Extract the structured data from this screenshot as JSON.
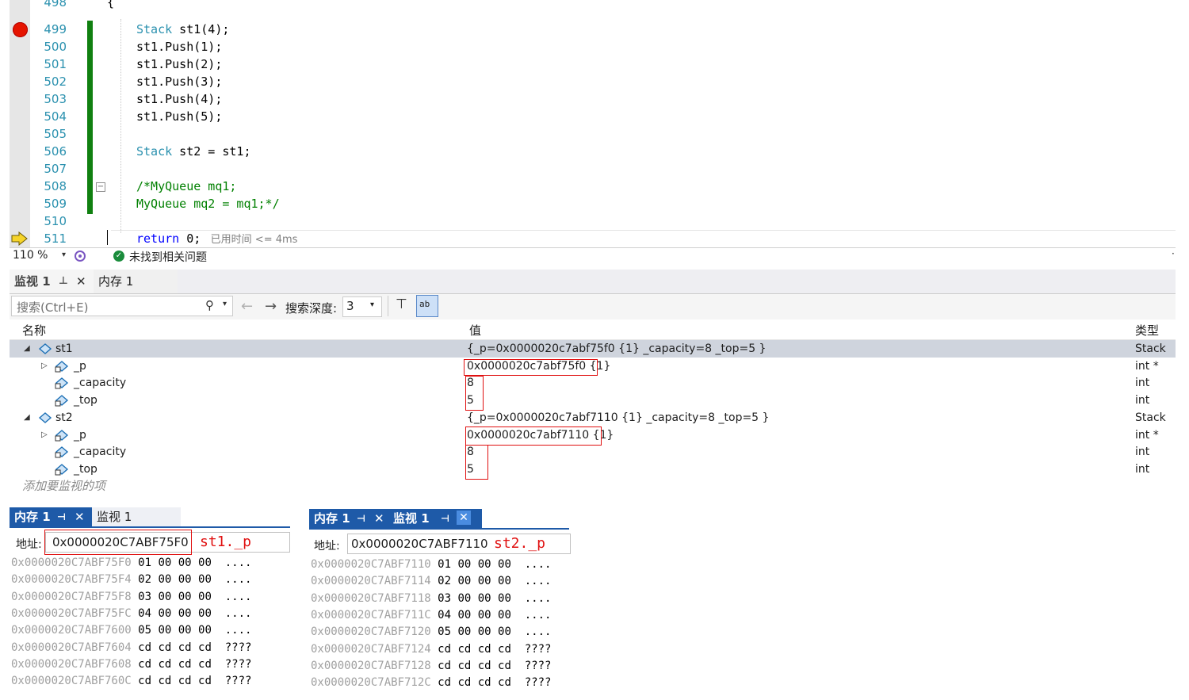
{
  "editor": {
    "lines": [
      {
        "num": "498",
        "code_parts": [
          {
            "t": "{",
            "c": "plain"
          }
        ]
      },
      {
        "num": "499",
        "code_parts": [
          {
            "t": "Stack",
            "c": "kw-type"
          },
          {
            "t": " st1(4);",
            "c": "plain"
          }
        ]
      },
      {
        "num": "500",
        "code_parts": [
          {
            "t": "st1.Push(1);",
            "c": "plain"
          }
        ]
      },
      {
        "num": "501",
        "code_parts": [
          {
            "t": "st1.Push(2);",
            "c": "plain"
          }
        ]
      },
      {
        "num": "502",
        "code_parts": [
          {
            "t": "st1.Push(3);",
            "c": "plain"
          }
        ]
      },
      {
        "num": "503",
        "code_parts": [
          {
            "t": "st1.Push(4);",
            "c": "plain"
          }
        ]
      },
      {
        "num": "504",
        "code_parts": [
          {
            "t": "st1.Push(5);",
            "c": "plain"
          }
        ]
      },
      {
        "num": "505",
        "code_parts": []
      },
      {
        "num": "506",
        "code_parts": [
          {
            "t": "Stack",
            "c": "kw-type"
          },
          {
            "t": " st2 = st1;",
            "c": "plain"
          }
        ]
      },
      {
        "num": "507",
        "code_parts": []
      },
      {
        "num": "508",
        "code_parts": [
          {
            "t": "/*MyQueue mq1;",
            "c": "comment"
          }
        ]
      },
      {
        "num": "509",
        "code_parts": [
          {
            "t": "MyQueue mq2 = mq1;*/",
            "c": "comment"
          }
        ]
      },
      {
        "num": "510",
        "code_parts": []
      },
      {
        "num": "511",
        "code_parts": [
          {
            "t": "return",
            "c": "kw"
          },
          {
            "t": " 0;",
            "c": "plain"
          }
        ]
      }
    ],
    "elapsed_hint": "已用时间 <= 4ms"
  },
  "status": {
    "zoom": "110 %",
    "issues": "未找到相关问题"
  },
  "watch": {
    "tabs": {
      "watch1": "监视 1",
      "memory1": "内存 1"
    },
    "search_placeholder": "搜索(Ctrl+E)",
    "search_depth_label": "搜索深度:",
    "search_depth_value": "3",
    "columns": {
      "name": "名称",
      "value": "值",
      "type": "类型"
    },
    "rows": [
      {
        "name": "st1",
        "value": "{_p=0x0000020c7abf75f0 {1} _capacity=8 _top=5 }",
        "type": "Stack"
      },
      {
        "name": "_p",
        "value": "0x0000020c7abf75f0 {1}",
        "type": "int *"
      },
      {
        "name": "_capacity",
        "value": "8",
        "type": "int"
      },
      {
        "name": "_top",
        "value": "5",
        "type": "int"
      },
      {
        "name": "st2",
        "value": "{_p=0x0000020c7abf7110 {1} _capacity=8 _top=5 }",
        "type": "Stack"
      },
      {
        "name": "_p",
        "value": "0x0000020c7abf7110 {1}",
        "type": "int *"
      },
      {
        "name": "_capacity",
        "value": "8",
        "type": "int"
      },
      {
        "name": "_top",
        "value": "5",
        "type": "int"
      }
    ],
    "add_item_placeholder": "添加要监视的项"
  },
  "memory_left": {
    "tab_memory": "内存 1",
    "tab_watch": "监视 1",
    "address_label": "地址:",
    "address_value": "0x0000020C7ABF75F0",
    "note": "st1._p",
    "rows": [
      {
        "addr": "0x0000020C7ABF75F0",
        "bytes": "01 00 00 00",
        "ascii": "...."
      },
      {
        "addr": "0x0000020C7ABF75F4",
        "bytes": "02 00 00 00",
        "ascii": "...."
      },
      {
        "addr": "0x0000020C7ABF75F8",
        "bytes": "03 00 00 00",
        "ascii": "...."
      },
      {
        "addr": "0x0000020C7ABF75FC",
        "bytes": "04 00 00 00",
        "ascii": "...."
      },
      {
        "addr": "0x0000020C7ABF7600",
        "bytes": "05 00 00 00",
        "ascii": "...."
      },
      {
        "addr": "0x0000020C7ABF7604",
        "bytes": "cd cd cd cd",
        "ascii": "????"
      },
      {
        "addr": "0x0000020C7ABF7608",
        "bytes": "cd cd cd cd",
        "ascii": "????"
      },
      {
        "addr": "0x0000020C7ABF760C",
        "bytes": "cd cd cd cd",
        "ascii": "????"
      }
    ]
  },
  "memory_right": {
    "tab_memory": "内存 1",
    "tab_watch": "监视 1",
    "address_label": "地址:",
    "address_value": "0x0000020C7ABF7110",
    "note": "st2._p",
    "rows": [
      {
        "addr": "0x0000020C7ABF7110",
        "bytes": "01 00 00 00",
        "ascii": "...."
      },
      {
        "addr": "0x0000020C7ABF7114",
        "bytes": "02 00 00 00",
        "ascii": "...."
      },
      {
        "addr": "0x0000020C7ABF7118",
        "bytes": "03 00 00 00",
        "ascii": "...."
      },
      {
        "addr": "0x0000020C7ABF711C",
        "bytes": "04 00 00 00",
        "ascii": "...."
      },
      {
        "addr": "0x0000020C7ABF7120",
        "bytes": "05 00 00 00",
        "ascii": "...."
      },
      {
        "addr": "0x0000020C7ABF7124",
        "bytes": "cd cd cd cd",
        "ascii": "????"
      },
      {
        "addr": "0x0000020C7ABF7128",
        "bytes": "cd cd cd cd",
        "ascii": "????"
      },
      {
        "addr": "0x0000020C7ABF712C",
        "bytes": "cd cd cd cd",
        "ascii": "????"
      }
    ]
  },
  "colors": {
    "breakpoint": "#e51400",
    "change_bar": "#108010",
    "highlight_box": "#e01010",
    "memory_tab": "#1e5aa8"
  }
}
